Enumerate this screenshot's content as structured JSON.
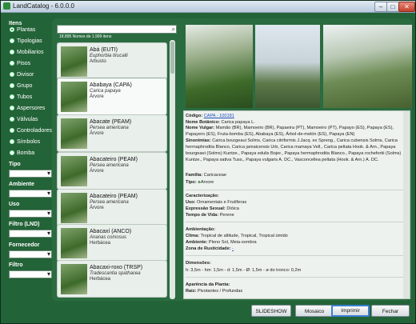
{
  "window": {
    "title": "LandCatalog - 6.0.0.0",
    "min": "–",
    "max": "□",
    "close": "✕"
  },
  "sidebar": {
    "items_heading": "Itens",
    "items": [
      {
        "label": "Plantas",
        "selected": true
      },
      {
        "label": "Tipologias",
        "selected": false
      },
      {
        "label": "Mobiliarios",
        "selected": false
      },
      {
        "label": "Pisos",
        "selected": false
      },
      {
        "label": "Divisor",
        "selected": false
      },
      {
        "label": "Grupo",
        "selected": false
      },
      {
        "label": "Tubos",
        "selected": false
      },
      {
        "label": "Aspersores",
        "selected": false
      },
      {
        "label": "Válvulas",
        "selected": false
      },
      {
        "label": "Controladores",
        "selected": false
      },
      {
        "label": "Símbolos",
        "selected": false
      },
      {
        "label": "Bomba",
        "selected": false
      }
    ],
    "filters": [
      {
        "label": "Tipo"
      },
      {
        "label": "Ambiente"
      },
      {
        "label": "Uso"
      },
      {
        "label": "Filtro (LND)"
      },
      {
        "label": "Fornecedor"
      },
      {
        "label": "Filtro"
      }
    ]
  },
  "search": {
    "placeholder": "",
    "count_text": "18.895 Nomes de 1.999 itens"
  },
  "list": [
    {
      "name": "Abá (EUTI)",
      "sci": "Euphorbia tirucalli",
      "type": "Arbusto",
      "selected": false
    },
    {
      "name": "Ababaya (CAPA)",
      "sci": "Carica papaya",
      "type": "Árvore",
      "selected": true
    },
    {
      "name": "Abacate (PEAM)",
      "sci": "Persea americana",
      "type": "Árvore",
      "selected": false
    },
    {
      "name": "Abacateiro (PEAM)",
      "sci": "Persea americana",
      "type": "Árvore",
      "selected": false
    },
    {
      "name": "Abacateiro (PEAM)",
      "sci": "Persea americana",
      "type": "Árvore",
      "selected": false
    },
    {
      "name": "Abacaxí (ANCO)",
      "sci": "Ananas comosus",
      "type": "Herbácea",
      "selected": false
    },
    {
      "name": "Abacaxi-roxo (TRSP)",
      "sci": "Tradescantia spathacea",
      "type": "Herbácea",
      "selected": false
    }
  ],
  "detail": {
    "codigo_label": "Código:",
    "codigo_value": "CAPA - 100181",
    "nome_bot_label": "Nome Botânico:",
    "nome_bot_value": "Carica papaya L.",
    "nome_vulgar_label": "Nome Vulgar:",
    "nome_vulgar_value": "Mamão (BR), Mamoeiro (BR), Papaeira (PT), Mamoeiro (PT), Papayo (ES), Papaya (ES), Papayero (ES), Fruta-bomba (ES), Ababaya (ES), Árbol-de-melón (ES), Papaya (EN)",
    "sinonimias_label": "Sinonímias:",
    "sinonimias_value": "Carica bourgeaui Solms, Carica citriformis J.Jacq. ex Spreng., Carica cubensis Solms, Carica hermaphrodita Blanco, Carica jamaicensis Urb, Carica mamaya Vell., Carica peltata Hook. & Arn., Papaya bourgeaei (Solms) Kuntze., Papaya edulis Bojer., Papaya hermaphrodita Blanco., Papaya rochefortii (Solms) Kuntze., Papaya sativa Tuss., Papaya vulgaris A. DC., Vasconcellea peltata (Hook. & Arn.) A. DC.",
    "familia_label": "Família:",
    "familia_value": "Caricaceae",
    "tipo_label": "Tipo:",
    "tipo_value": "Árvore",
    "caracterizacao_label": "Caracterização:",
    "uso_label": "Uso:",
    "uso_value": "Ornamentais e Frutíferas",
    "expressao_label": "Expressão Sexual:",
    "expressao_value": "Dióica",
    "tempo_label": "Tempo de Vida:",
    "tempo_value": "Perene",
    "ambientacao_label": "Ambientação:",
    "clima_label": "Clima:",
    "clima_value": "Tropical de altitude, Tropical, Tropical úmido",
    "ambiente_label": "Ambiente:",
    "ambiente_value": "Pleno Sol, Meia-sombra",
    "zona_label": "Zona de Rusticidade:",
    "zona_value": "-",
    "dimensoes_label": "Dimensões:",
    "dimensoes_value": "h: 3,5m - hm: 1,5m - d: 1,5m - Ø: 1,5m - ø do tronco: 0,2m",
    "aparencia_label": "Aparência da Planta:",
    "raiz_label": "Raiz:",
    "raiz_value": "Pivotantes / Profundas"
  },
  "buttons": {
    "slideshow": "SLIDESHOW",
    "mosaico": "Mosaico",
    "imprimir": "Imprimir",
    "fechar": "Fechar"
  }
}
